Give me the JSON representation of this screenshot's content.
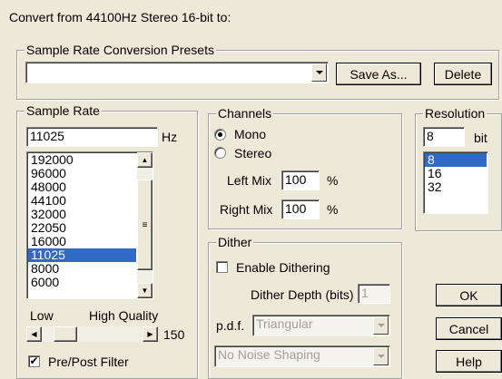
{
  "header": {
    "title": "Convert from 44100Hz Stereo 16-bit to:"
  },
  "presets": {
    "legend": "Sample Rate Conversion Presets",
    "value": "",
    "save_as_label": "Save As...",
    "delete_label": "Delete"
  },
  "sample_rate": {
    "legend": "Sample Rate",
    "value": "11025",
    "unit": "Hz",
    "items": [
      "192000",
      "96000",
      "48000",
      "44100",
      "32000",
      "22050",
      "16000",
      "11025",
      "8000",
      "6000"
    ],
    "selected": "11025",
    "slider_low_label": "Low",
    "slider_high_label": "High Quality",
    "slider_value": "150",
    "filter_label": "Pre/Post Filter",
    "filter_checked": true
  },
  "channels": {
    "legend": "Channels",
    "mono_label": "Mono",
    "stereo_label": "Stereo",
    "selected": "Mono",
    "left_mix_label": "Left Mix",
    "left_mix_value": "100",
    "right_mix_label": "Right Mix",
    "right_mix_value": "100",
    "percent_symbol": "%"
  },
  "resolution": {
    "legend": "Resolution",
    "value": "8",
    "unit": "bit",
    "items": [
      "8",
      "16",
      "32"
    ],
    "selected": "8"
  },
  "dither": {
    "legend": "Dither",
    "enable_label": "Enable Dithering",
    "enable_checked": false,
    "depth_label": "Dither Depth (bits)",
    "depth_value": "1",
    "pdf_label": "p.d.f.",
    "pdf_value": "Triangular",
    "noise_shaping_value": "No Noise Shaping"
  },
  "buttons": {
    "ok_label": "OK",
    "cancel_label": "Cancel",
    "help_label": "Help"
  }
}
